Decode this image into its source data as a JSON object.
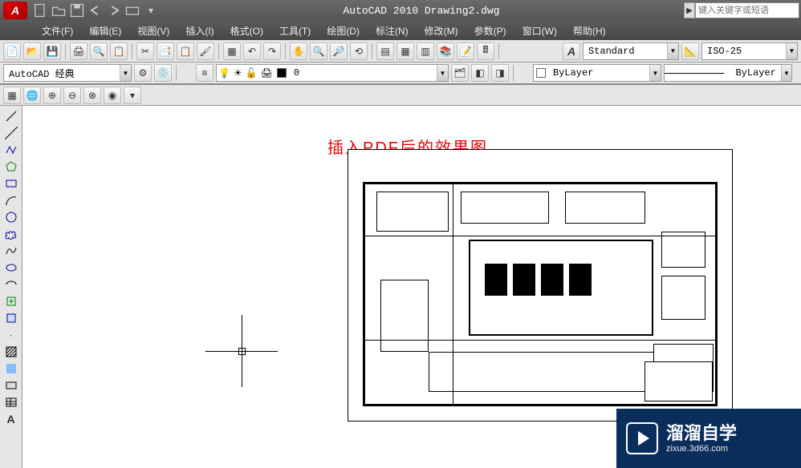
{
  "title": "AutoCAD 2010   Drawing2.dwg",
  "search_placeholder": "键入关键字或短语",
  "menu": [
    "文件(F)",
    "编辑(E)",
    "视图(V)",
    "插入(I)",
    "格式(O)",
    "工具(T)",
    "绘图(D)",
    "标注(N)",
    "修改(M)",
    "参数(P)",
    "窗口(W)",
    "帮助(H)"
  ],
  "textstyle": "Standard",
  "dimstyle": "ISO-25",
  "workspace": "AutoCAD 经典",
  "layer_name": "0",
  "linetype_layer": "ByLayer",
  "linetype_name": "ByLayer",
  "annotation_text": "插入PDF后的效果图",
  "watermark": {
    "title": "溜溜自学",
    "sub": "zixue.3d66.com"
  }
}
